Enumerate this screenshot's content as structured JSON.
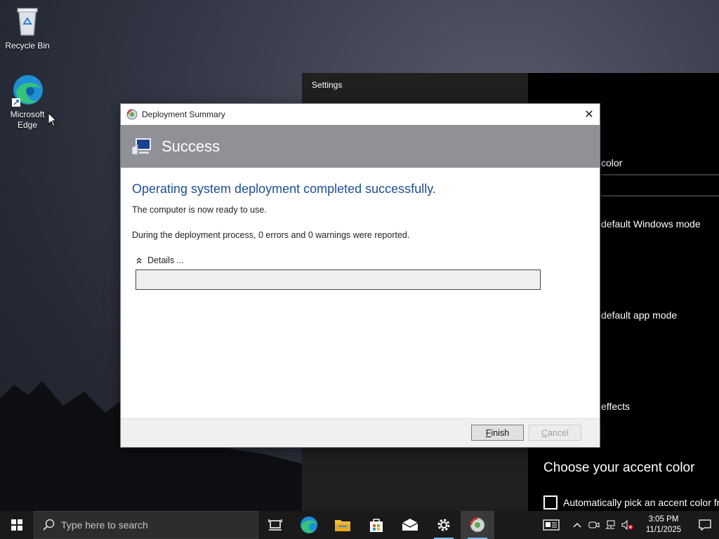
{
  "desktop": {
    "icons": [
      {
        "label": "Recycle Bin",
        "icon": "recycle-bin-icon"
      },
      {
        "label": "Microsoft Edge",
        "icon": "edge-icon"
      }
    ]
  },
  "settings_window": {
    "title": "Settings",
    "rows": [
      "color",
      "default Windows mode",
      "default app mode",
      "effects"
    ],
    "section_heading": "Choose your accent color",
    "checkbox_label": "Automatically pick an accent color fr"
  },
  "dialog": {
    "title": "Deployment Summary",
    "header_title": "Success",
    "headline": "Operating system deployment completed successfully.",
    "line1": "The computer is now ready to use.",
    "line2": "During the deployment process, 0 errors and 0 warnings were reported.",
    "details_label": "Details ...",
    "details_value": "",
    "buttons": {
      "finish": "Finish",
      "cancel": "Cancel"
    },
    "close_glyph": "✕"
  },
  "taskbar": {
    "search_placeholder": "Type here to search",
    "apps": [
      "task-view-icon",
      "edge-icon",
      "file-explorer-icon",
      "microsoft-store-icon",
      "mail-icon",
      "settings-icon",
      "deployment-icon"
    ],
    "clock": {
      "time": "3:05 PM",
      "date": "11/1/2025"
    }
  },
  "colors": {
    "header_band": "#8f9196",
    "headline": "#1d4f95",
    "taskbar": "#1a1a1a",
    "accent": "#76b9ed"
  }
}
